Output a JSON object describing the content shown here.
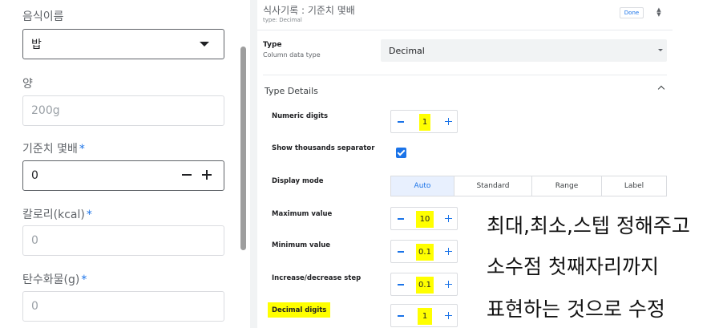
{
  "form": {
    "fields": [
      {
        "label": "음식이름",
        "required": false,
        "value": "밥",
        "placeholder": ""
      },
      {
        "label": "양",
        "required": false,
        "value": "",
        "placeholder": "200g"
      },
      {
        "label": "기준치 몇배",
        "required": true,
        "value": "0",
        "placeholder": ""
      },
      {
        "label": "칼로리(kcal)",
        "required": true,
        "value": "",
        "placeholder": "0"
      },
      {
        "label": "탄수화물(g)",
        "required": true,
        "value": "",
        "placeholder": "0"
      }
    ],
    "required_mark": "*"
  },
  "editor": {
    "title": "식사기록 : 기준치 몇배",
    "subtitle": "type: Decimal",
    "done_label": "Done",
    "type": {
      "label": "Type",
      "sub": "Column data type",
      "value": "Decimal"
    },
    "section_title": "Type Details",
    "numeric_digits": {
      "label": "Numeric digits",
      "value": "1"
    },
    "thousands_sep": {
      "label": "Show thousands separator",
      "checked": true
    },
    "display_mode": {
      "label": "Display mode",
      "options": [
        "Auto",
        "Standard",
        "Range",
        "Label"
      ],
      "selected": "Auto"
    },
    "max_value": {
      "label": "Maximum value",
      "value": "10"
    },
    "min_value": {
      "label": "Minimum value",
      "value": "0.1"
    },
    "step": {
      "label": "Increase/decrease step",
      "value": "0.1"
    },
    "decimal_digits": {
      "label": "Decimal digits",
      "value": "1"
    }
  },
  "annotation": {
    "line1": "최대,최소,스텝 정해주고",
    "line2": "소수점 첫째자리까지",
    "line3": "표현하는 것으로 수정"
  },
  "colors": {
    "accent": "#1a73e8",
    "highlight": "#ffff00"
  }
}
